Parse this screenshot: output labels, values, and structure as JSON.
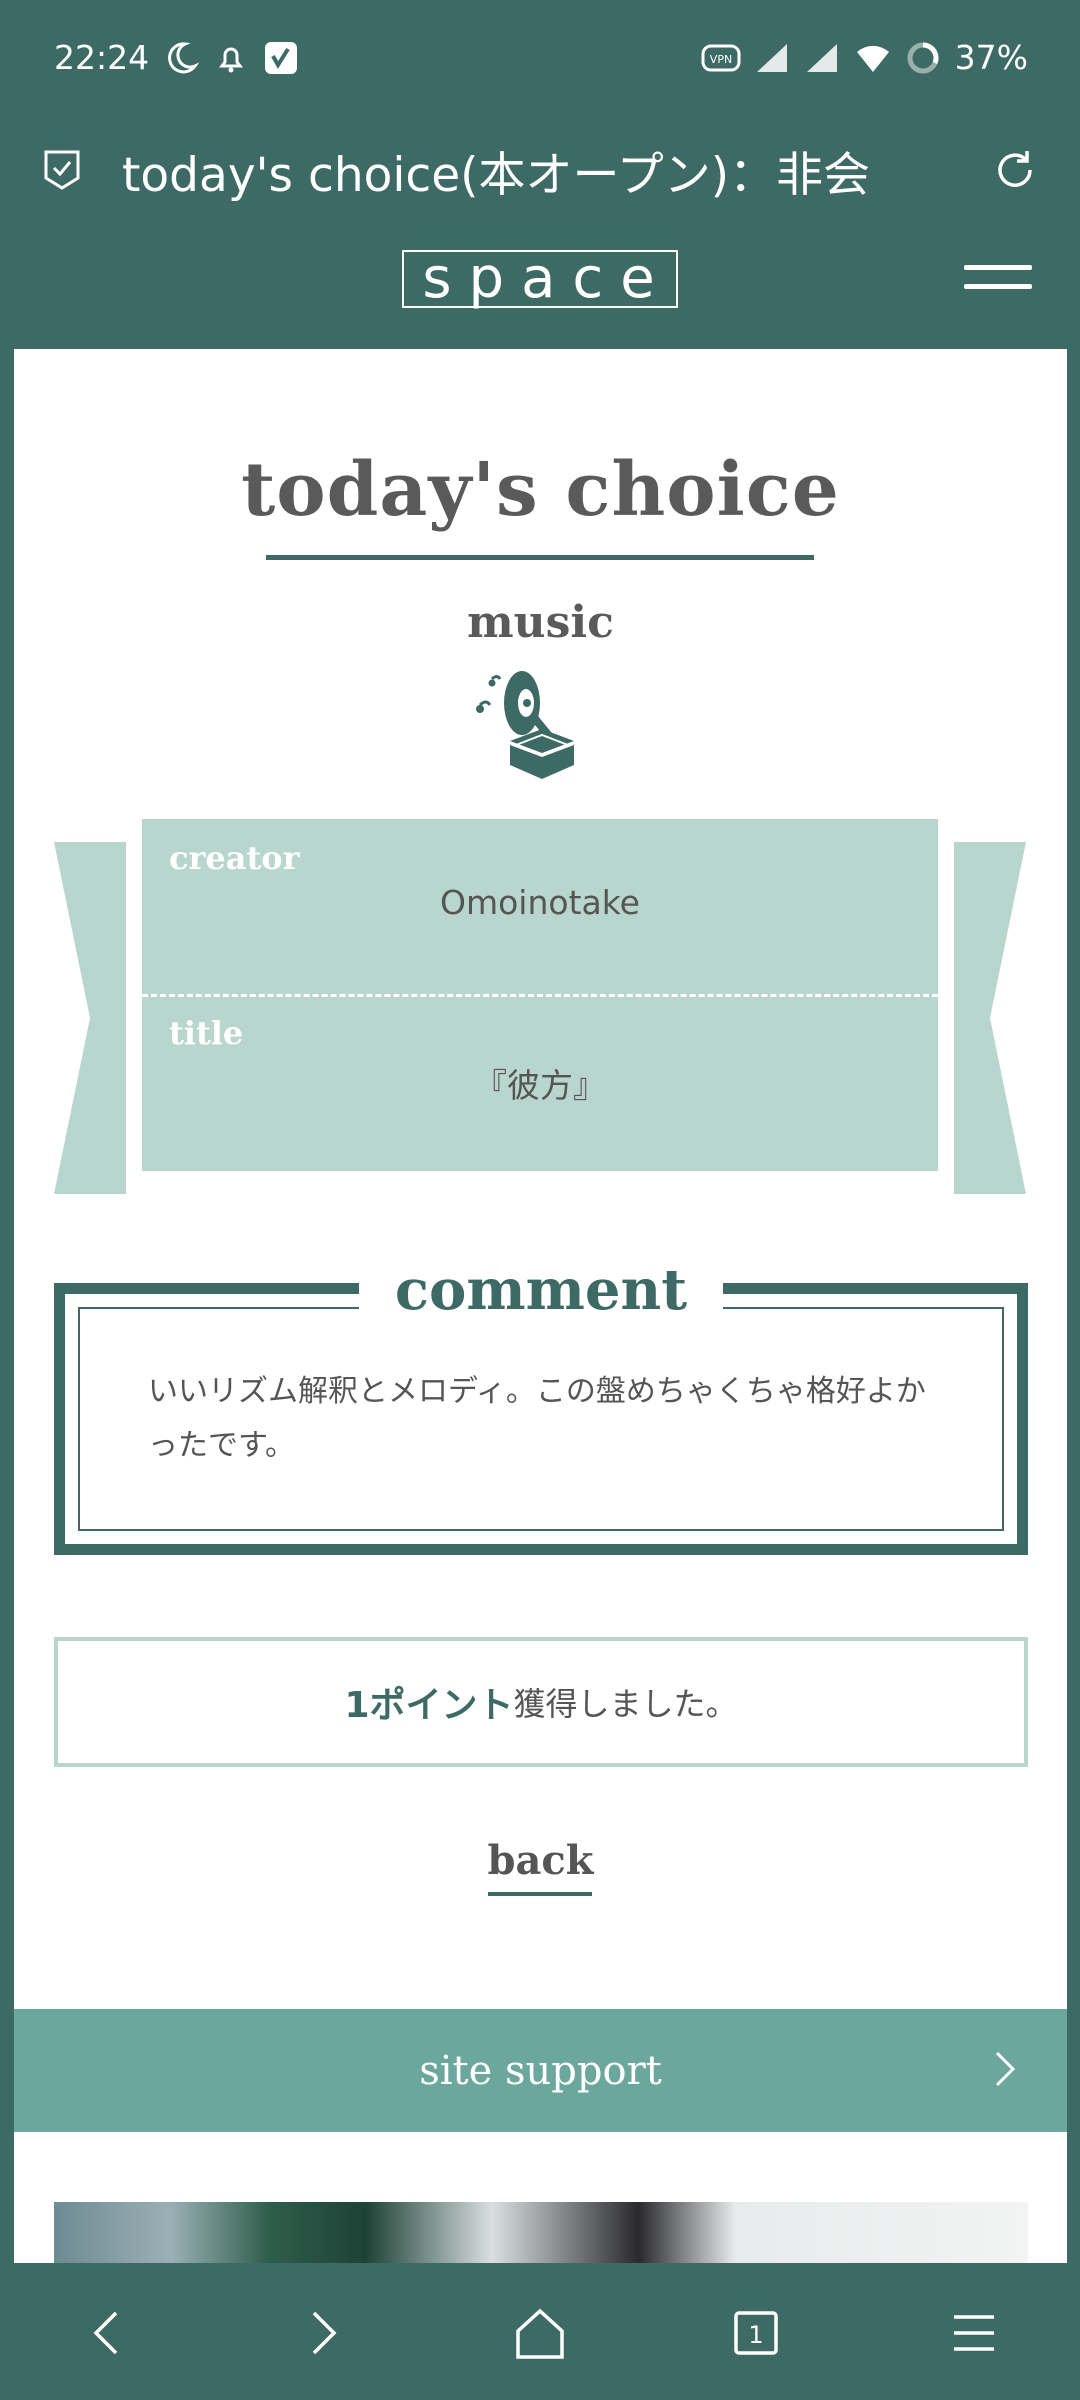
{
  "status_bar": {
    "time": "22:24",
    "battery": "37%",
    "vpn": "VPN"
  },
  "browser": {
    "url_title": "today's choice(本オープン)：非会",
    "tab_count": "1"
  },
  "site": {
    "logo": "space"
  },
  "content": {
    "heading": "today's choice",
    "category": "music",
    "creator_label": "creator",
    "creator_value": "Omoinotake",
    "title_label": "title",
    "title_value": "『彼方』",
    "comment_heading": "comment",
    "comment_text": "いいリズム解釈とメロディ。この盤めちゃくちゃ格好よかったです。",
    "points_highlight": "1ポイント",
    "points_rest": "獲得しました。",
    "back_label": "back",
    "support_label": "site support"
  },
  "colors": {
    "brand": "#3d6a65",
    "accent_light": "#b9d6ce",
    "support_bar": "#6ba79c"
  },
  "icons": {
    "gramophone": "gramophone-icon",
    "menu": "hamburger-menu-icon",
    "reload": "reload-icon",
    "shield": "shield-check-icon"
  }
}
